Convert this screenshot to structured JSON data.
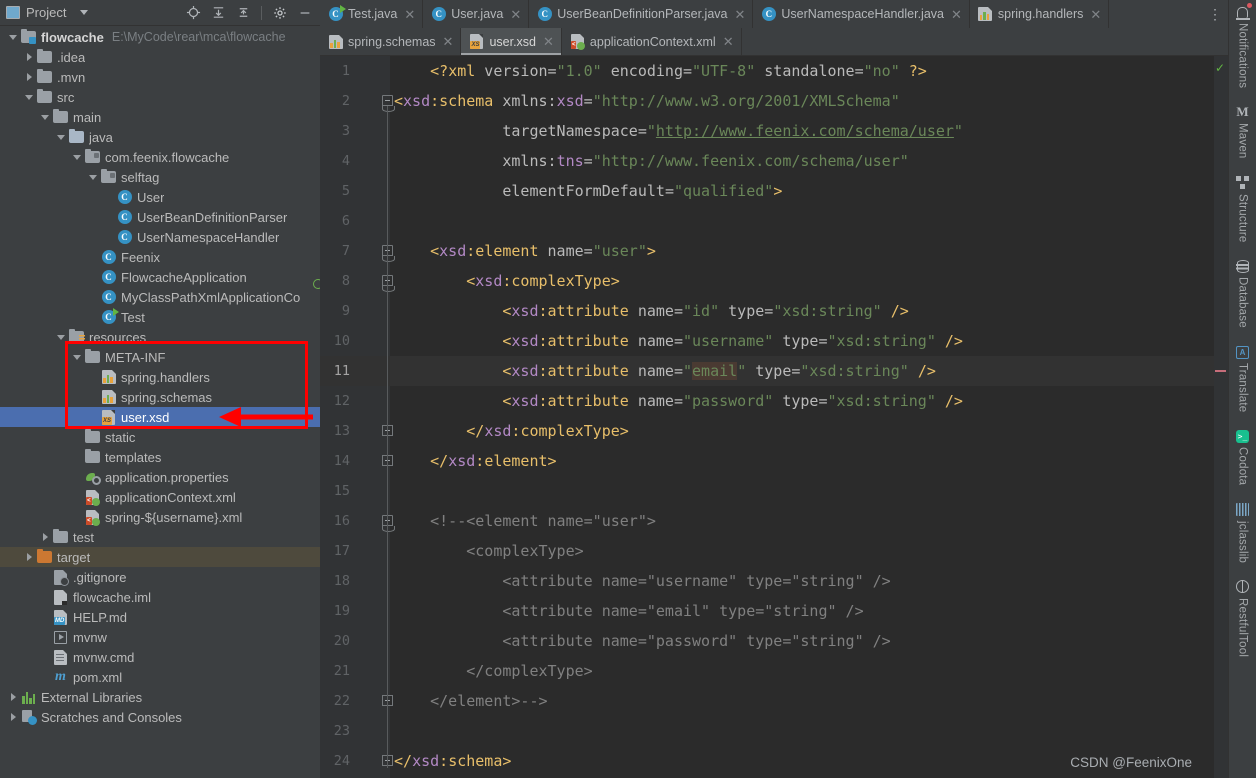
{
  "project_panel": {
    "title": "Project",
    "icon": "project-icon",
    "toolbar": [
      {
        "name": "locate-icon",
        "label": "Select Opened File"
      },
      {
        "name": "expand-all-icon",
        "label": "Expand All"
      },
      {
        "name": "collapse-all-icon",
        "label": "Collapse All"
      },
      {
        "name": "gear-icon",
        "label": "Settings"
      },
      {
        "name": "minimize-icon",
        "label": "Hide"
      }
    ],
    "tree": [
      {
        "depth": 0,
        "label": "flowcache",
        "path": "E:\\MyCode\\rear\\mca\\flowcache",
        "icon": "module-folder-icon",
        "twig": "down",
        "bold": true
      },
      {
        "depth": 1,
        "label": ".idea",
        "icon": "folder-icon",
        "twig": "right"
      },
      {
        "depth": 1,
        "label": ".mvn",
        "icon": "folder-icon",
        "twig": "right"
      },
      {
        "depth": 1,
        "label": "src",
        "icon": "folder-icon",
        "twig": "down"
      },
      {
        "depth": 2,
        "label": "main",
        "icon": "folder-icon",
        "twig": "down"
      },
      {
        "depth": 3,
        "label": "java",
        "icon": "source-folder-icon",
        "twig": "down"
      },
      {
        "depth": 4,
        "label": "com.feenix.flowcache",
        "icon": "package-icon",
        "twig": "down"
      },
      {
        "depth": 5,
        "label": "selftag",
        "icon": "package-icon",
        "twig": "down"
      },
      {
        "depth": 6,
        "label": "User",
        "icon": "java-class-icon",
        "twig": "none"
      },
      {
        "depth": 6,
        "label": "UserBeanDefinitionParser",
        "icon": "java-class-icon",
        "twig": "none"
      },
      {
        "depth": 6,
        "label": "UserNamespaceHandler",
        "icon": "java-class-icon",
        "twig": "none"
      },
      {
        "depth": 5,
        "label": "Feenix",
        "icon": "java-class-icon",
        "twig": "none"
      },
      {
        "depth": 5,
        "label": "FlowcacheApplication",
        "icon": "spring-boot-class-icon",
        "twig": "none"
      },
      {
        "depth": 5,
        "label": "MyClassPathXmlApplicationCo",
        "icon": "java-class-icon",
        "twig": "none"
      },
      {
        "depth": 5,
        "label": "Test",
        "icon": "runnable-class-icon",
        "twig": "none"
      },
      {
        "depth": 3,
        "label": "resources",
        "icon": "resource-folder-icon",
        "twig": "down"
      },
      {
        "depth": 4,
        "label": "META-INF",
        "icon": "folder-icon",
        "twig": "down"
      },
      {
        "depth": 5,
        "label": "spring.handlers",
        "icon": "properties-file-icon",
        "twig": "none"
      },
      {
        "depth": 5,
        "label": "spring.schemas",
        "icon": "properties-file-icon",
        "twig": "none"
      },
      {
        "depth": 5,
        "label": "user.xsd",
        "icon": "xsd-file-icon",
        "twig": "none",
        "selected": true
      },
      {
        "depth": 4,
        "label": "static",
        "icon": "folder-icon",
        "twig": "none"
      },
      {
        "depth": 4,
        "label": "templates",
        "icon": "folder-icon",
        "twig": "none"
      },
      {
        "depth": 4,
        "label": "application.properties",
        "icon": "spring-properties-icon",
        "twig": "none"
      },
      {
        "depth": 4,
        "label": "applicationContext.xml",
        "icon": "spring-xml-icon",
        "twig": "none"
      },
      {
        "depth": 4,
        "label": "spring-${username}.xml",
        "icon": "spring-xml-icon",
        "twig": "none"
      },
      {
        "depth": 2,
        "label": "test",
        "icon": "folder-icon",
        "twig": "right"
      },
      {
        "depth": 1,
        "label": "target",
        "icon": "excluded-folder-icon",
        "twig": "right",
        "highlighted": true
      },
      {
        "depth": 2,
        "label": ".gitignore",
        "icon": "gitignore-icon",
        "twig": "none"
      },
      {
        "depth": 2,
        "label": "flowcache.iml",
        "icon": "iml-file-icon",
        "twig": "none"
      },
      {
        "depth": 2,
        "label": "HELP.md",
        "icon": "markdown-file-icon",
        "twig": "none"
      },
      {
        "depth": 2,
        "label": "mvnw",
        "icon": "shell-script-icon",
        "twig": "none"
      },
      {
        "depth": 2,
        "label": "mvnw.cmd",
        "icon": "cmd-script-icon",
        "twig": "none"
      },
      {
        "depth": 2,
        "label": "pom.xml",
        "icon": "maven-pom-icon",
        "twig": "none"
      },
      {
        "depth": 0,
        "label": "External Libraries",
        "icon": "libraries-icon",
        "twig": "right"
      },
      {
        "depth": 0,
        "label": "Scratches and Consoles",
        "icon": "scratches-icon",
        "twig": "right"
      }
    ]
  },
  "annotation": {
    "box_color": "#ff0000",
    "arrow_color": "#ff0000",
    "points_to": "user.xsd"
  },
  "editor": {
    "tabs_row1": [
      {
        "label": "Test.java",
        "icon": "runnable-class-icon",
        "active": false
      },
      {
        "label": "User.java",
        "icon": "java-class-icon",
        "active": false
      },
      {
        "label": "UserBeanDefinitionParser.java",
        "icon": "java-class-icon",
        "active": false
      },
      {
        "label": "UserNamespaceHandler.java",
        "icon": "java-class-icon",
        "active": false
      },
      {
        "label": "spring.handlers",
        "icon": "properties-file-icon",
        "active": false
      }
    ],
    "tabs_row2": [
      {
        "label": "spring.schemas",
        "icon": "properties-file-icon",
        "active": false
      },
      {
        "label": "user.xsd",
        "icon": "xsd-file-icon",
        "active": true
      },
      {
        "label": "applicationContext.xml",
        "icon": "spring-xml-icon",
        "active": false
      }
    ],
    "tab_overflow_label": "⋮",
    "current_line": 11,
    "inspection_status": "ok",
    "lines": [
      {
        "n": 1,
        "fold": "none",
        "tokens": [
          {
            "t": "    ",
            "c": "plain"
          },
          {
            "t": "<?",
            "c": "tk-pi"
          },
          {
            "t": "xml",
            "c": "tk-pi"
          },
          {
            "t": " version",
            "c": "tk-attr"
          },
          {
            "t": "=",
            "c": "tk-eq"
          },
          {
            "t": "\"1.0\"",
            "c": "tk-val"
          },
          {
            "t": " encoding",
            "c": "tk-attr"
          },
          {
            "t": "=",
            "c": "tk-eq"
          },
          {
            "t": "\"UTF-8\"",
            "c": "tk-val"
          },
          {
            "t": " standalone",
            "c": "tk-attr"
          },
          {
            "t": "=",
            "c": "tk-eq"
          },
          {
            "t": "\"no\"",
            "c": "tk-val"
          },
          {
            "t": " ",
            "c": "plain"
          },
          {
            "t": "?>",
            "c": "tk-pi"
          }
        ]
      },
      {
        "n": 2,
        "fold": "start",
        "tokens": [
          {
            "t": "<",
            "c": "tk-tag"
          },
          {
            "t": "xsd",
            "c": "tk-ns"
          },
          {
            "t": ":",
            "c": "tk-tag"
          },
          {
            "t": "schema",
            "c": "tk-tag"
          },
          {
            "t": " xmlns:",
            "c": "tk-attr"
          },
          {
            "t": "xsd",
            "c": "tk-ns"
          },
          {
            "t": "=",
            "c": "tk-eq"
          },
          {
            "t": "\"http://www.w3.org/2001/XMLSchema\"",
            "c": "tk-val"
          }
        ]
      },
      {
        "n": 3,
        "fold": "none",
        "tokens": [
          {
            "t": "            targetNamespace",
            "c": "tk-attr"
          },
          {
            "t": "=",
            "c": "tk-eq"
          },
          {
            "t": "\"",
            "c": "tk-val"
          },
          {
            "t": "http://www.feenix.com/schema/user",
            "c": "tk-link"
          },
          {
            "t": "\"",
            "c": "tk-val"
          }
        ]
      },
      {
        "n": 4,
        "fold": "none",
        "tokens": [
          {
            "t": "            xmlns:",
            "c": "tk-attr"
          },
          {
            "t": "tns",
            "c": "tk-ns"
          },
          {
            "t": "=",
            "c": "tk-eq"
          },
          {
            "t": "\"http://www.feenix.com/schema/user\"",
            "c": "tk-val"
          }
        ]
      },
      {
        "n": 5,
        "fold": "none",
        "tokens": [
          {
            "t": "            elementFormDefault",
            "c": "tk-attr"
          },
          {
            "t": "=",
            "c": "tk-eq"
          },
          {
            "t": "\"qualified\"",
            "c": "tk-val"
          },
          {
            "t": ">",
            "c": "tk-tag"
          }
        ]
      },
      {
        "n": 6,
        "fold": "none",
        "tokens": []
      },
      {
        "n": 7,
        "fold": "start",
        "tokens": [
          {
            "t": "    ",
            "c": "plain"
          },
          {
            "t": "<",
            "c": "tk-tag"
          },
          {
            "t": "xsd",
            "c": "tk-ns"
          },
          {
            "t": ":",
            "c": "tk-tag"
          },
          {
            "t": "element",
            "c": "tk-tag"
          },
          {
            "t": " name",
            "c": "tk-attr"
          },
          {
            "t": "=",
            "c": "tk-eq"
          },
          {
            "t": "\"user\"",
            "c": "tk-val"
          },
          {
            "t": ">",
            "c": "tk-tag"
          }
        ]
      },
      {
        "n": 8,
        "fold": "start",
        "tokens": [
          {
            "t": "        ",
            "c": "plain"
          },
          {
            "t": "<",
            "c": "tk-tag"
          },
          {
            "t": "xsd",
            "c": "tk-ns"
          },
          {
            "t": ":",
            "c": "tk-tag"
          },
          {
            "t": "complexType",
            "c": "tk-tag"
          },
          {
            "t": ">",
            "c": "tk-tag"
          }
        ]
      },
      {
        "n": 9,
        "fold": "none",
        "tokens": [
          {
            "t": "            ",
            "c": "plain"
          },
          {
            "t": "<",
            "c": "tk-tag"
          },
          {
            "t": "xsd",
            "c": "tk-ns"
          },
          {
            "t": ":",
            "c": "tk-tag"
          },
          {
            "t": "attribute",
            "c": "tk-tag"
          },
          {
            "t": " name",
            "c": "tk-attr"
          },
          {
            "t": "=",
            "c": "tk-eq"
          },
          {
            "t": "\"id\"",
            "c": "tk-val"
          },
          {
            "t": " type",
            "c": "tk-attr"
          },
          {
            "t": "=",
            "c": "tk-eq"
          },
          {
            "t": "\"xsd:string\"",
            "c": "tk-val"
          },
          {
            "t": " ",
            "c": "plain"
          },
          {
            "t": "/>",
            "c": "tk-tag"
          }
        ]
      },
      {
        "n": 10,
        "fold": "none",
        "tokens": [
          {
            "t": "            ",
            "c": "plain"
          },
          {
            "t": "<",
            "c": "tk-tag"
          },
          {
            "t": "xsd",
            "c": "tk-ns"
          },
          {
            "t": ":",
            "c": "tk-tag"
          },
          {
            "t": "attribute",
            "c": "tk-tag"
          },
          {
            "t": " name",
            "c": "tk-attr"
          },
          {
            "t": "=",
            "c": "tk-eq"
          },
          {
            "t": "\"username\"",
            "c": "tk-val"
          },
          {
            "t": " type",
            "c": "tk-attr"
          },
          {
            "t": "=",
            "c": "tk-eq"
          },
          {
            "t": "\"xsd:string\"",
            "c": "tk-val"
          },
          {
            "t": " ",
            "c": "plain"
          },
          {
            "t": "/>",
            "c": "tk-tag"
          }
        ]
      },
      {
        "n": 11,
        "fold": "none",
        "current": true,
        "tokens": [
          {
            "t": "            ",
            "c": "plain"
          },
          {
            "t": "<",
            "c": "tk-tag"
          },
          {
            "t": "xsd",
            "c": "tk-ns"
          },
          {
            "t": ":",
            "c": "tk-tag"
          },
          {
            "t": "attribute",
            "c": "tk-tag"
          },
          {
            "t": " name",
            "c": "tk-attr"
          },
          {
            "t": "=",
            "c": "tk-eq"
          },
          {
            "t": "\"",
            "c": "tk-val"
          },
          {
            "t": "email",
            "c": "tk-val caret-hl"
          },
          {
            "t": "\"",
            "c": "tk-val"
          },
          {
            "t": " type",
            "c": "tk-attr"
          },
          {
            "t": "=",
            "c": "tk-eq"
          },
          {
            "t": "\"xsd:string\"",
            "c": "tk-val"
          },
          {
            "t": " ",
            "c": "plain"
          },
          {
            "t": "/>",
            "c": "tk-tag"
          }
        ]
      },
      {
        "n": 12,
        "fold": "none",
        "tokens": [
          {
            "t": "            ",
            "c": "plain"
          },
          {
            "t": "<",
            "c": "tk-tag"
          },
          {
            "t": "xsd",
            "c": "tk-ns"
          },
          {
            "t": ":",
            "c": "tk-tag"
          },
          {
            "t": "attribute",
            "c": "tk-tag"
          },
          {
            "t": " name",
            "c": "tk-attr"
          },
          {
            "t": "=",
            "c": "tk-eq"
          },
          {
            "t": "\"password\"",
            "c": "tk-val"
          },
          {
            "t": " type",
            "c": "tk-attr"
          },
          {
            "t": "=",
            "c": "tk-eq"
          },
          {
            "t": "\"xsd:string\"",
            "c": "tk-val"
          },
          {
            "t": " ",
            "c": "plain"
          },
          {
            "t": "/>",
            "c": "tk-tag"
          }
        ]
      },
      {
        "n": 13,
        "fold": "end",
        "tokens": [
          {
            "t": "        ",
            "c": "plain"
          },
          {
            "t": "</",
            "c": "tk-tag"
          },
          {
            "t": "xsd",
            "c": "tk-ns"
          },
          {
            "t": ":",
            "c": "tk-tag"
          },
          {
            "t": "complexType",
            "c": "tk-tag"
          },
          {
            "t": ">",
            "c": "tk-tag"
          }
        ]
      },
      {
        "n": 14,
        "fold": "end",
        "tokens": [
          {
            "t": "    ",
            "c": "plain"
          },
          {
            "t": "</",
            "c": "tk-tag"
          },
          {
            "t": "xsd",
            "c": "tk-ns"
          },
          {
            "t": ":",
            "c": "tk-tag"
          },
          {
            "t": "element",
            "c": "tk-tag"
          },
          {
            "t": ">",
            "c": "tk-tag"
          }
        ]
      },
      {
        "n": 15,
        "fold": "none",
        "tokens": []
      },
      {
        "n": 16,
        "fold": "start",
        "tokens": [
          {
            "t": "    <!--<element name=\"user\">",
            "c": "tk-comment"
          }
        ]
      },
      {
        "n": 17,
        "fold": "none",
        "tokens": [
          {
            "t": "        <complexType>",
            "c": "tk-comment"
          }
        ]
      },
      {
        "n": 18,
        "fold": "none",
        "tokens": [
          {
            "t": "            <attribute name=\"username\" type=\"string\" />",
            "c": "tk-comment"
          }
        ]
      },
      {
        "n": 19,
        "fold": "none",
        "tokens": [
          {
            "t": "            <attribute name=\"email\" type=\"string\" />",
            "c": "tk-comment"
          }
        ]
      },
      {
        "n": 20,
        "fold": "none",
        "tokens": [
          {
            "t": "            <attribute name=\"password\" type=\"string\" />",
            "c": "tk-comment"
          }
        ]
      },
      {
        "n": 21,
        "fold": "none",
        "tokens": [
          {
            "t": "        </complexType>",
            "c": "tk-comment"
          }
        ]
      },
      {
        "n": 22,
        "fold": "end",
        "tokens": [
          {
            "t": "    </element>-->",
            "c": "tk-comment"
          }
        ]
      },
      {
        "n": 23,
        "fold": "none",
        "tokens": []
      },
      {
        "n": 24,
        "fold": "end",
        "tokens": [
          {
            "t": "</",
            "c": "tk-tag"
          },
          {
            "t": "xsd",
            "c": "tk-ns"
          },
          {
            "t": ":",
            "c": "tk-tag"
          },
          {
            "t": "schema",
            "c": "tk-tag"
          },
          {
            "t": ">",
            "c": "tk-tag"
          }
        ]
      }
    ]
  },
  "right_stripe": [
    {
      "label": "Notifications",
      "icon": "bell-icon",
      "badge": true
    },
    {
      "label": "Maven",
      "icon": "maven-icon",
      "badge": false
    },
    {
      "label": "Structure",
      "icon": "structure-icon",
      "badge": false
    },
    {
      "label": "Database",
      "icon": "database-icon",
      "badge": false
    },
    {
      "label": "Translate",
      "icon": "translate-icon",
      "badge": false
    },
    {
      "label": "Codota",
      "icon": "codota-icon",
      "badge": false
    },
    {
      "label": "jclasslib",
      "icon": "jclasslib-icon",
      "badge": false
    },
    {
      "label": "RestfulTool",
      "icon": "restful-tool-icon",
      "badge": false
    }
  ],
  "watermark": "CSDN @FeenixOne"
}
